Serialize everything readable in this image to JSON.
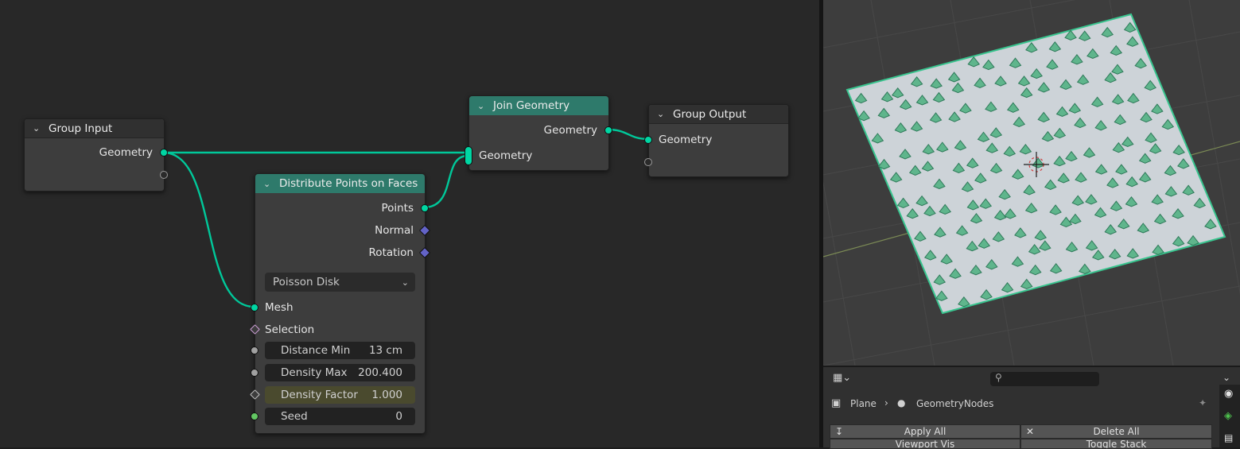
{
  "node_editor": {
    "group_input": {
      "title": "Group Input",
      "output_geometry": "Geometry"
    },
    "join_geometry": {
      "title": "Join Geometry",
      "output_geometry": "Geometry",
      "input_geometry": "Geometry"
    },
    "group_output": {
      "title": "Group Output",
      "input_geometry": "Geometry"
    },
    "distribute": {
      "title": "Distribute Points on Faces",
      "outputs": {
        "points": "Points",
        "normal": "Normal",
        "rotation": "Rotation"
      },
      "method": "Poisson Disk",
      "inputs": {
        "mesh": "Mesh",
        "selection": "Selection"
      },
      "fields": {
        "distance_min": {
          "label": "Distance Min",
          "value": "13 cm"
        },
        "density_max": {
          "label": "Density Max",
          "value": "200.400"
        },
        "density_factor": {
          "label": "Density Factor",
          "value": "1.000"
        },
        "seed": {
          "label": "Seed",
          "value": "0"
        }
      }
    },
    "colors": {
      "geometry_socket": "#00d6a3",
      "link": "#00c89a",
      "join_header": "#2e7a6b"
    }
  },
  "properties": {
    "breadcrumb": {
      "object": "Plane",
      "modifier": "GeometryNodes"
    },
    "buttons": {
      "apply_all": "Apply All",
      "delete_all": "Delete All",
      "viewport_vis": "Viewport Vis",
      "toggle_stack": "Toggle Stack"
    },
    "search": {
      "placeholder": ""
    }
  }
}
